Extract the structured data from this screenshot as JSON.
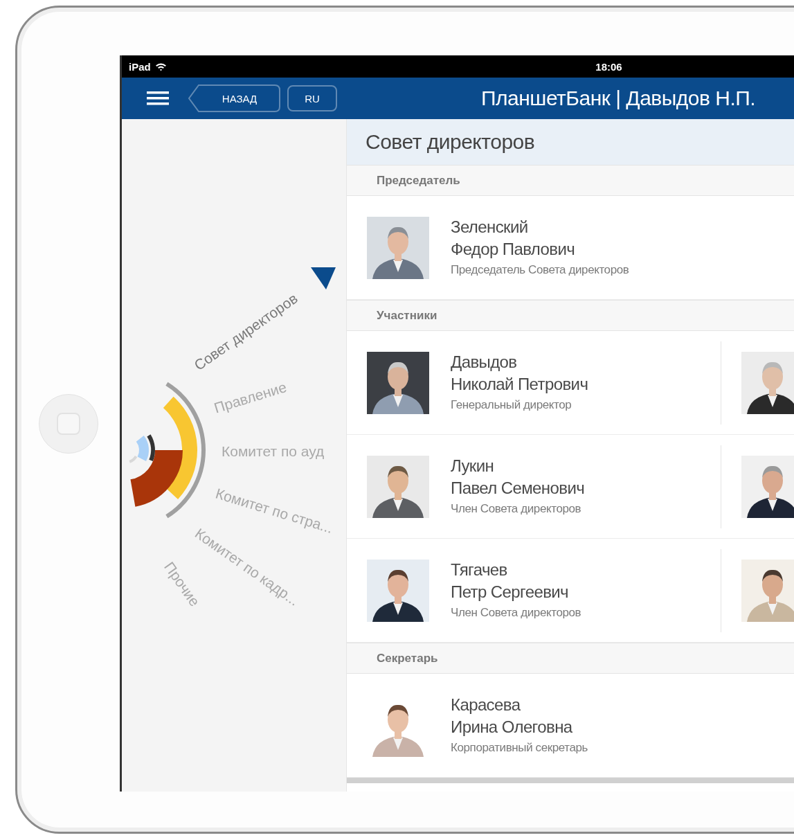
{
  "status_bar": {
    "device": "iPad",
    "time": "18:06"
  },
  "nav_bar": {
    "back_button": "НАЗАД",
    "language_button": "RU",
    "title": "ПланшетБанк | Давыдов Н.П."
  },
  "side_menu": {
    "items": [
      {
        "label": "Совет директоров",
        "selected": true
      },
      {
        "label": "Правление",
        "selected": false
      },
      {
        "label": "Комитет по ауд",
        "selected": false
      },
      {
        "label": "Комитет по стра...",
        "selected": false
      },
      {
        "label": "Комитет по кадр...",
        "selected": false
      },
      {
        "label": "Прочие",
        "selected": false
      }
    ]
  },
  "page": {
    "title": "Совет директоров",
    "sections": [
      {
        "header": "Председатель",
        "rows": [
          {
            "surname": "Зеленский",
            "given_names": "Федор Павлович",
            "role": "Председатель Совета директоров"
          }
        ]
      },
      {
        "header": "Участники",
        "rows": [
          {
            "surname": "Давыдов",
            "given_names": "Николай Петрович",
            "role": "Генеральный директор"
          },
          {
            "surname": "Лукин",
            "given_names": "Павел Семенович",
            "role": "Член Совета директоров"
          },
          {
            "surname": "Тягачев",
            "given_names": "Петр Сергеевич",
            "role": "Член Совета директоров"
          }
        ]
      },
      {
        "header": "Секретарь",
        "rows": [
          {
            "surname": "Карасева",
            "given_names": "Ирина Олеговна",
            "role": "Корпоративный секретарь"
          }
        ]
      }
    ]
  }
}
